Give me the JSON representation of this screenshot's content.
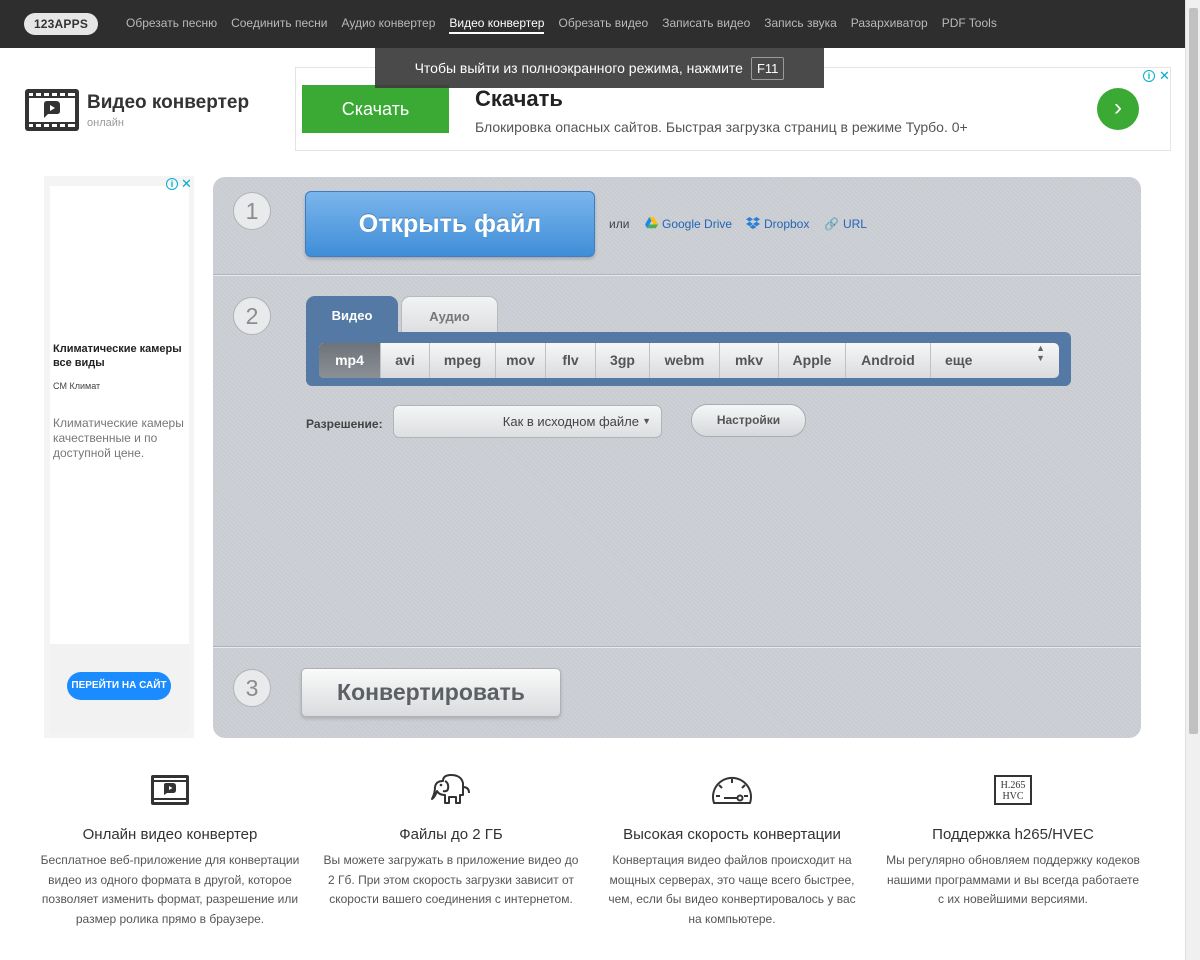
{
  "nav": {
    "logo": "123APPS",
    "items": [
      {
        "label": "Обрезать песню"
      },
      {
        "label": "Соединить песни"
      },
      {
        "label": "Аудио конвертер"
      },
      {
        "label": "Видео конвертер"
      },
      {
        "label": "Обрезать видео"
      },
      {
        "label": "Записать видео"
      },
      {
        "label": "Запись звука"
      },
      {
        "label": "Разархиватор"
      },
      {
        "label": "PDF Tools"
      }
    ],
    "active_index": 3
  },
  "fullscreen_notice": {
    "text": "Чтобы выйти из полноэкранного режима, нажмите",
    "key": "F11"
  },
  "app": {
    "title": "Видео конвертер",
    "subtitle": "онлайн"
  },
  "top_ad": {
    "button_label": "Скачать",
    "title": "Скачать",
    "text": "Блокировка опасных сайтов. Быстрая загрузка страниц в режиме Турбо. 0+",
    "arrow": "›",
    "accent_color": "#3aaa35"
  },
  "left_ad": {
    "title": "Климатические камеры все виды",
    "brand": "CM Климат",
    "text": "Климатические камеры качественные и по доступной цене.",
    "cta": "ПЕРЕЙТИ НА САЙТ"
  },
  "converter": {
    "steps": [
      "1",
      "2",
      "3"
    ],
    "open_file_label": "Открыть файл",
    "or_label": "или",
    "sources": [
      {
        "label": "Google Drive",
        "icon": "google-drive-icon"
      },
      {
        "label": "Dropbox",
        "icon": "dropbox-icon"
      },
      {
        "label": "URL",
        "icon": "link-icon"
      }
    ],
    "tabs": [
      {
        "label": "Видео"
      },
      {
        "label": "Аудио"
      }
    ],
    "formats": [
      {
        "label": "mp4"
      },
      {
        "label": "avi"
      },
      {
        "label": "mpeg"
      },
      {
        "label": "mov"
      },
      {
        "label": "flv"
      },
      {
        "label": "3gp"
      },
      {
        "label": "webm"
      },
      {
        "label": "mkv"
      },
      {
        "label": "Apple"
      },
      {
        "label": "Android"
      },
      {
        "label": "еще"
      }
    ],
    "selected_format": "mp4",
    "resolution_label": "Разрешение:",
    "resolution_value": "Как в исходном файле",
    "settings_label": "Настройки",
    "convert_label": "Конвертировать"
  },
  "features": [
    {
      "icon": "video-icon",
      "title": "Онлайн видео конвертер",
      "text": "Бесплатное веб-приложение для конвертации видео из одного формата в другой, которое позволяет изменить формат, разрешение или размер ролика прямо в браузере."
    },
    {
      "icon": "elephant-icon",
      "title": "Файлы до 2 ГБ",
      "text": "Вы можете загружать в приложение видео до 2 Гб. При этом скорость загрузки зависит от скорости вашего соединения с интернетом."
    },
    {
      "icon": "speedometer-icon",
      "title": "Высокая скорость конвертации",
      "text": "Конвертация видео файлов происходит на мощных серверах, это чаще всего быстрее, чем, если бы видео конвертировалось у вас на компьютере."
    },
    {
      "icon": "codec-icon",
      "title": "Поддержка h265/HVEC",
      "text": "Мы регулярно обновляем поддержку кодеков нашими программами и вы всегда работаете с их новейшими версиями.",
      "icon_text": [
        "H.265",
        "HVC"
      ]
    }
  ]
}
